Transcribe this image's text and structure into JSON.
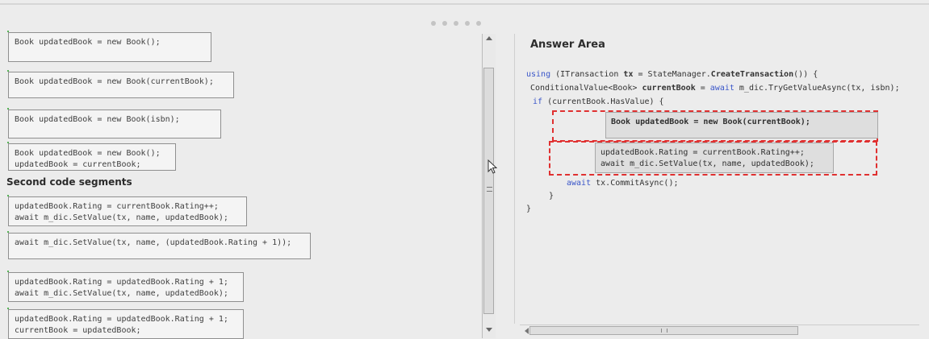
{
  "left_pane": {
    "first_segments": [
      {
        "lines": [
          "Book updatedBook = new Book();"
        ]
      },
      {
        "lines": [
          "Book updatedBook = new Book(currentBook);"
        ]
      },
      {
        "lines": [
          "Book updatedBook = new Book(isbn);"
        ]
      },
      {
        "lines": [
          "Book updatedBook = new Book();",
          "updatedBook = currentBook;"
        ]
      }
    ],
    "second_heading": "Second code segments",
    "second_segments": [
      {
        "lines": [
          "updatedBook.Rating = currentBook.Rating++;",
          "await m_dic.SetValue(tx, name, updatedBook);"
        ]
      },
      {
        "lines": [
          "await m_dic.SetValue(tx, name, (updatedBook.Rating + 1));"
        ]
      },
      {
        "lines": [
          "updatedBook.Rating = updatedBook.Rating + 1;",
          "await m_dic.SetValue(tx, name, updatedBook);"
        ]
      },
      {
        "lines": [
          "updatedBook.Rating = updatedBook.Rating + 1;",
          "currentBook = updatedBook;"
        ]
      }
    ]
  },
  "answer_area": {
    "title": "Answer Area",
    "code": {
      "line1_kw": "using",
      "line1_a": " (ITransaction ",
      "line1_tx": "tx",
      "line1_b": " = StateManager.",
      "line1_fn": "CreateTransaction",
      "line1_c": "()) {",
      "line2_a": "ConditionalValue<Book> ",
      "line2_var": "currentBook",
      "line2_b": " = ",
      "line2_kw": "await",
      "line2_c": " m_dic.TryGetValueAsync(tx, isbn);",
      "line3_kw": "if",
      "line3_a": " (currentBook.HasValue) {",
      "line4_kw": "await",
      "line4_a": " tx.CommitAsync();",
      "line5": "}",
      "line6": "}"
    },
    "placed_first": "Book updatedBook = new Book(currentBook);",
    "placed_second": [
      "updatedBook.Rating = currentBook.Rating++;",
      "await m_dic.SetValue(tx, name, updatedBook);"
    ]
  },
  "colors": {
    "keyword": "#3a56c9",
    "target_outline": "#e03030",
    "segment_outline": "#56b356"
  }
}
